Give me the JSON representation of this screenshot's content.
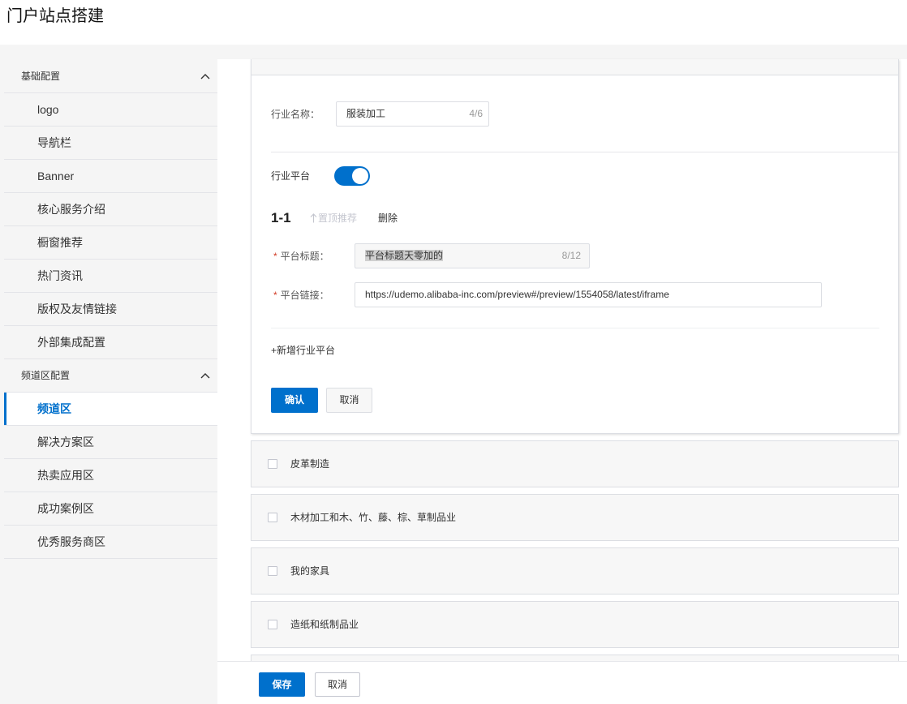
{
  "page": {
    "title": "门户站点搭建"
  },
  "colors": {
    "primary": "#0070cc",
    "required": "#d23c26",
    "text": "#333333",
    "muted": "#999999",
    "disabled": "#c4c6cf"
  },
  "sidebar": {
    "groups": [
      {
        "label": "基础配置",
        "expanded": true,
        "items": [
          {
            "label": "logo"
          },
          {
            "label": "导航栏"
          },
          {
            "label": "Banner"
          },
          {
            "label": "核心服务介绍"
          },
          {
            "label": "橱窗推荐"
          },
          {
            "label": "热门资讯"
          },
          {
            "label": "版权及友情链接"
          },
          {
            "label": "外部集成配置"
          }
        ]
      },
      {
        "label": "频道区配置",
        "expanded": true,
        "items": [
          {
            "label": "频道区",
            "active": true
          },
          {
            "label": "解决方案区"
          },
          {
            "label": "热卖应用区"
          },
          {
            "label": "成功案例区"
          },
          {
            "label": "优秀服务商区"
          }
        ]
      }
    ]
  },
  "editor": {
    "industry_name": {
      "label": "行业名称：",
      "value": "服装加工",
      "count": "4/6"
    },
    "platform_toggle": {
      "label": "行业平台",
      "enabled": true
    },
    "platforms": [
      {
        "index": "1-1",
        "pin_label": "置顶推荐",
        "pin_disabled": true,
        "delete_label": "删除",
        "title": {
          "required_mark": "*",
          "label": "平台标题：",
          "value": "平台标题天零加的",
          "count": "8/12"
        },
        "link": {
          "required_mark": "*",
          "label": "平台链接：",
          "value": "https://udemo.alibaba-inc.com/preview#/preview/1554058/latest/iframe"
        }
      }
    ],
    "add_platform_label": "+新增行业平台",
    "confirm_label": "确认",
    "cancel_label": "取消"
  },
  "industries": [
    {
      "name": "皮革制造",
      "checked": false
    },
    {
      "name": "木材加工和木、竹、藤、棕、草制品业",
      "checked": false
    },
    {
      "name": "我的家具",
      "checked": false
    },
    {
      "name": "造纸和纸制品业",
      "checked": false
    }
  ],
  "footer": {
    "save_label": "保存",
    "cancel_label": "取消"
  }
}
